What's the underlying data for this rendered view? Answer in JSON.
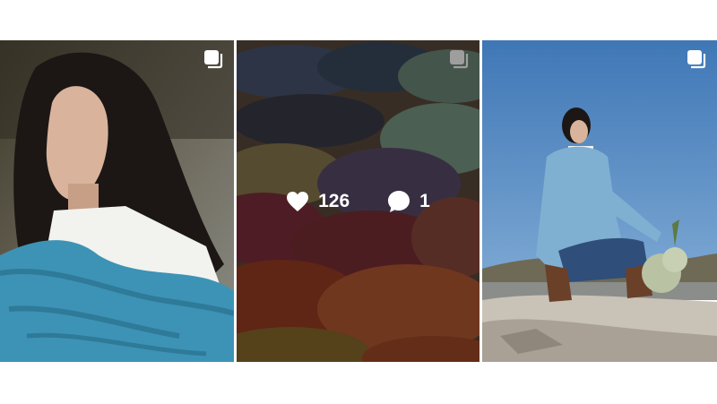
{
  "grid": {
    "posts": [
      {
        "type": "carousel",
        "icon": "multiple-images-icon"
      },
      {
        "type": "carousel",
        "icon": "multiple-images-icon",
        "hovered": true,
        "likes": "126",
        "comments": "1"
      },
      {
        "type": "carousel",
        "icon": "multiple-images-icon"
      }
    ]
  },
  "colors": {
    "sky": "#4a7fb8",
    "scarf": "#3d93b5",
    "overlay": "rgba(0,0,0,0.38)"
  }
}
